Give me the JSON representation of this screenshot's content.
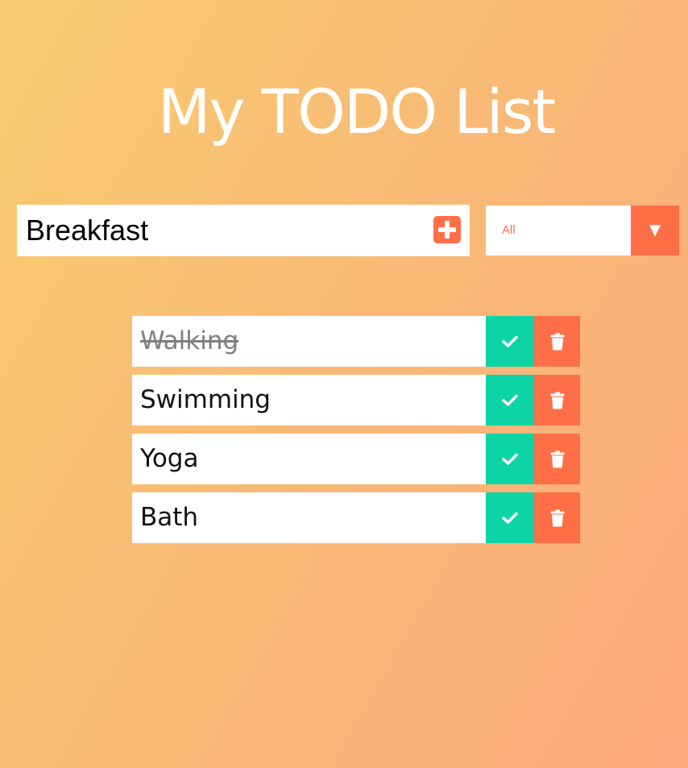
{
  "header": {
    "title": "My TODO List"
  },
  "form": {
    "input_value": "Breakfast",
    "add_icon": "plus-square-icon"
  },
  "filter": {
    "selected": "All",
    "arrow": "▼"
  },
  "todos": [
    {
      "text": "Walking",
      "completed": true
    },
    {
      "text": "Swimming",
      "completed": false
    },
    {
      "text": "Yoga",
      "completed": false
    },
    {
      "text": "Bath",
      "completed": false
    }
  ],
  "icons": {
    "complete": "check-icon",
    "delete": "trash-icon"
  },
  "colors": {
    "background_start": "#f9cc71",
    "background_end": "#fba97d",
    "accent": "#ff6f47",
    "complete": "#0dd4a5",
    "title": "#ffffff"
  }
}
